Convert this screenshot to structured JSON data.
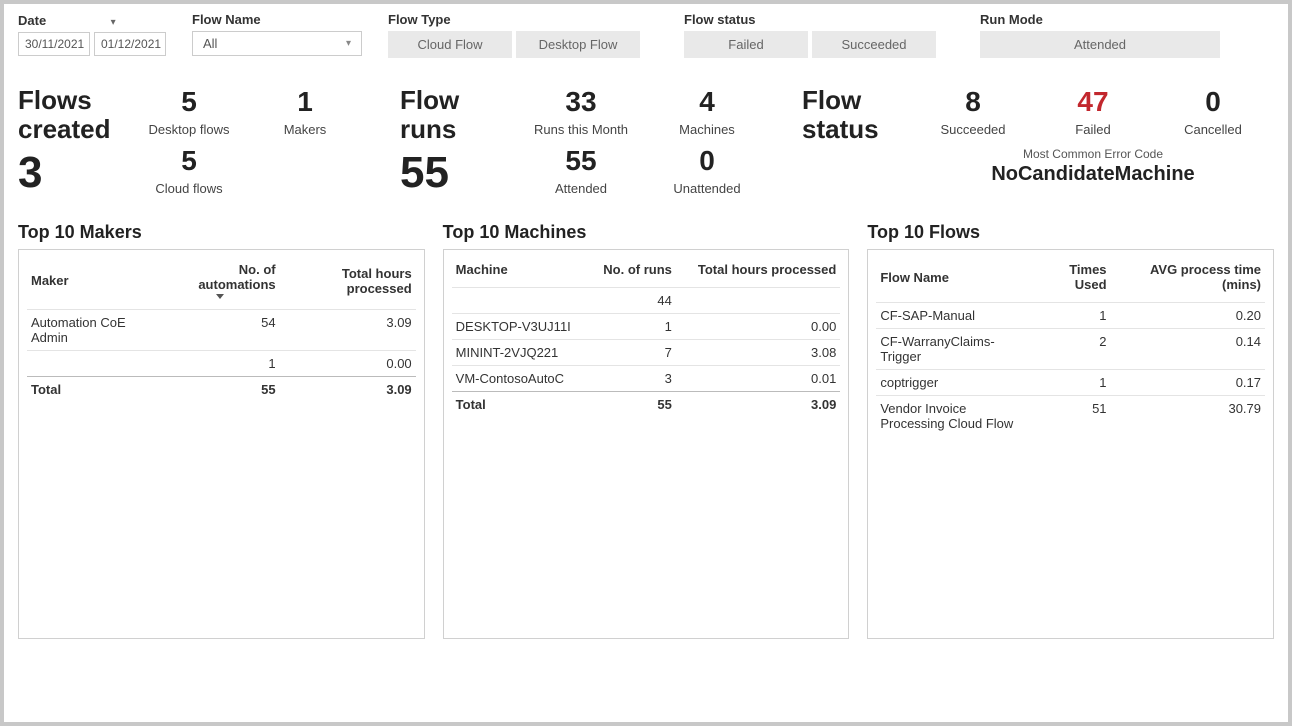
{
  "filters": {
    "date_label": "Date",
    "date_from": "30/11/2021",
    "date_to": "01/12/2021",
    "flow_name_label": "Flow Name",
    "flow_name_value": "All",
    "flow_type_label": "Flow Type",
    "flow_type_options": [
      "Cloud Flow",
      "Desktop Flow"
    ],
    "flow_status_label": "Flow status",
    "flow_status_options": [
      "Failed",
      "Succeeded"
    ],
    "run_mode_label": "Run Mode",
    "run_mode_options": [
      "Attended"
    ]
  },
  "kpi_flows_created": {
    "title": "Flows created",
    "value": "3",
    "desktop_flows": {
      "value": "5",
      "label": "Desktop flows"
    },
    "cloud_flows": {
      "value": "5",
      "label": "Cloud flows"
    },
    "makers": {
      "value": "1",
      "label": "Makers"
    }
  },
  "kpi_flow_runs": {
    "title": "Flow runs",
    "value": "55",
    "runs_month": {
      "value": "33",
      "label": "Runs this Month"
    },
    "attended": {
      "value": "55",
      "label": "Attended"
    },
    "machines": {
      "value": "4",
      "label": "Machines"
    },
    "unattended": {
      "value": "0",
      "label": "Unattended"
    }
  },
  "kpi_flow_status": {
    "title": "Flow status",
    "succeeded": {
      "value": "8",
      "label": "Succeeded"
    },
    "failed": {
      "value": "47",
      "label": "Failed"
    },
    "cancelled": {
      "value": "0",
      "label": "Cancelled"
    },
    "err_caption": "Most Common Error Code",
    "err_value": "NoCandidateMachine"
  },
  "table_makers": {
    "title": "Top 10 Makers",
    "headers": {
      "maker": "Maker",
      "count": "No. of automations",
      "hours": "Total hours processed"
    },
    "rows": [
      {
        "maker": "Automation CoE Admin",
        "count": "54",
        "hours": "3.09"
      },
      {
        "maker": "",
        "count": "1",
        "hours": "0.00"
      }
    ],
    "total": {
      "label": "Total",
      "count": "55",
      "hours": "3.09"
    }
  },
  "table_machines": {
    "title": "Top 10 Machines",
    "headers": {
      "machine": "Machine",
      "runs": "No. of runs",
      "hours": "Total hours processed"
    },
    "rows": [
      {
        "machine": "",
        "runs": "44",
        "hours": ""
      },
      {
        "machine": "DESKTOP-V3UJ11I",
        "runs": "1",
        "hours": "0.00"
      },
      {
        "machine": "MININT-2VJQ221",
        "runs": "7",
        "hours": "3.08"
      },
      {
        "machine": "VM-ContosoAutoC",
        "runs": "3",
        "hours": "0.01"
      }
    ],
    "total": {
      "label": "Total",
      "runs": "55",
      "hours": "3.09"
    }
  },
  "table_flows": {
    "title": "Top 10 Flows",
    "headers": {
      "name": "Flow Name",
      "used": "Times Used",
      "avg": "AVG process time (mins)"
    },
    "rows": [
      {
        "name": "CF-SAP-Manual",
        "used": "1",
        "avg": "0.20"
      },
      {
        "name": "CF-WarranyClaims-Trigger",
        "used": "2",
        "avg": "0.14"
      },
      {
        "name": "coptrigger",
        "used": "1",
        "avg": "0.17"
      },
      {
        "name": "Vendor Invoice Processing Cloud Flow",
        "used": "51",
        "avg": "30.79"
      }
    ]
  }
}
